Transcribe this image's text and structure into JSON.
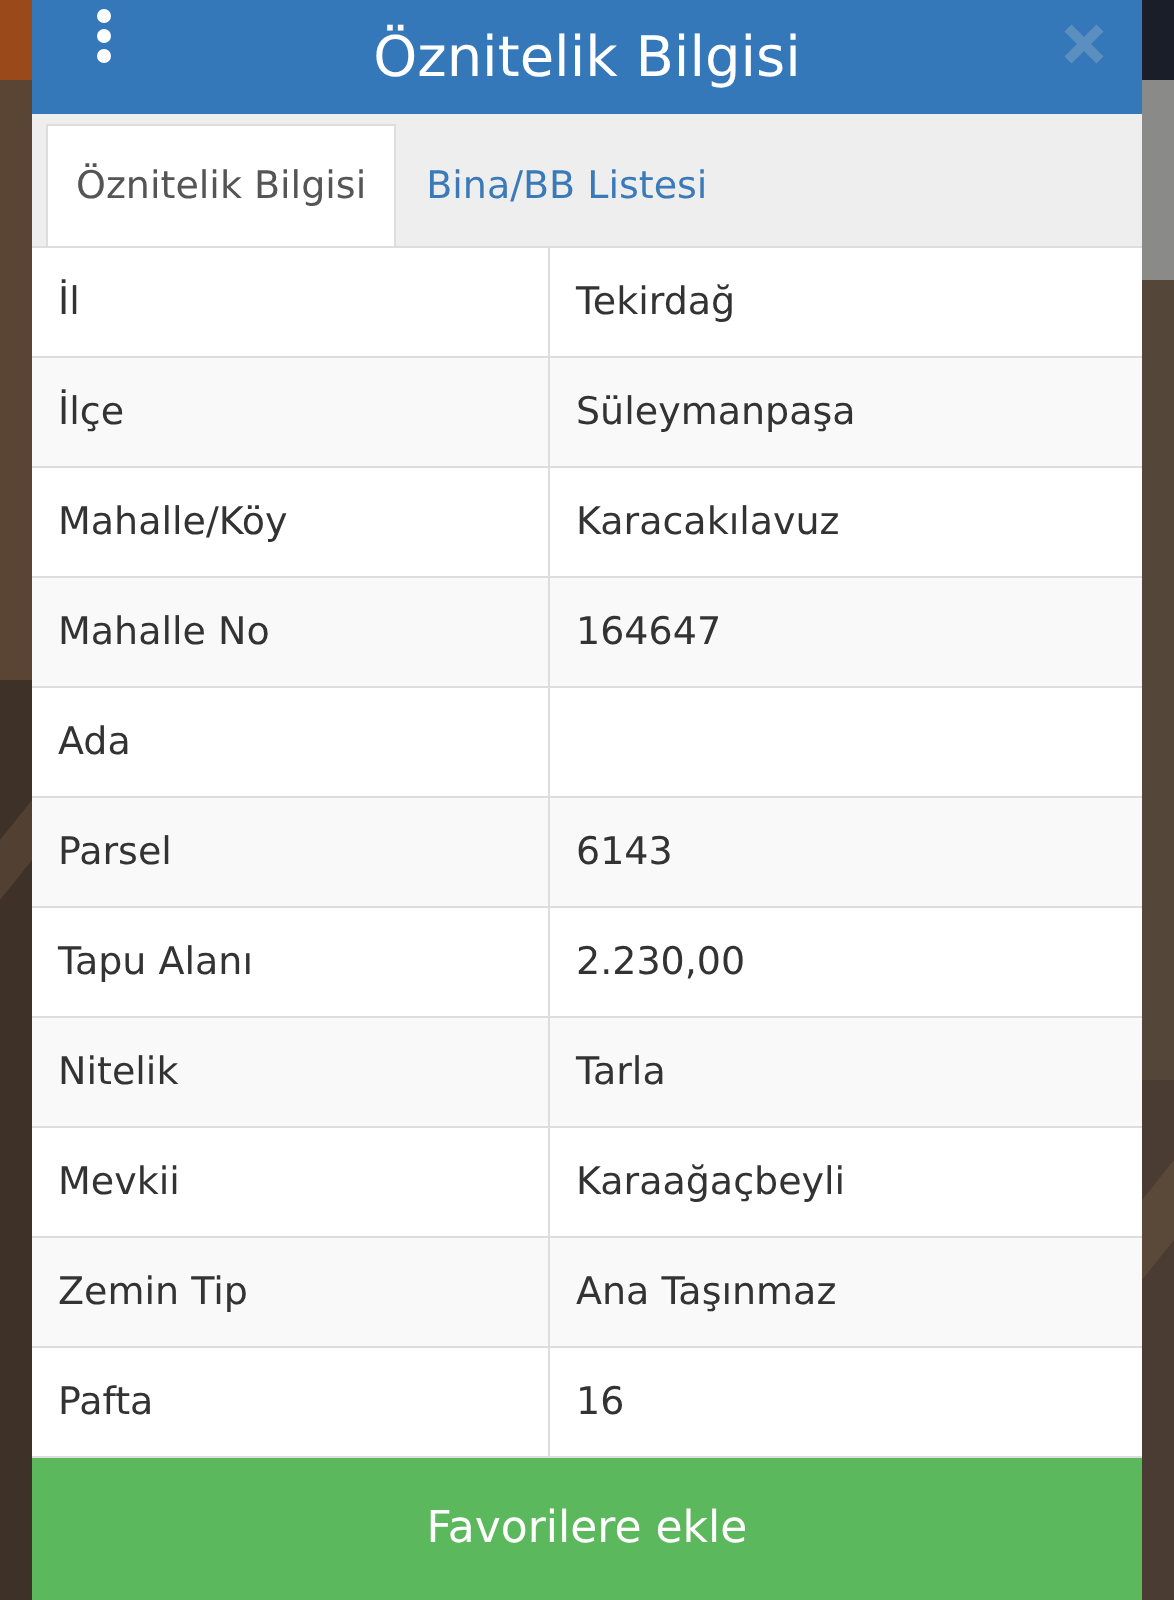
{
  "dialog": {
    "title": "Öznitelik Bilgisi"
  },
  "tabs": [
    {
      "label": "Öznitelik Bilgisi",
      "selected": true
    },
    {
      "label": "Bina/BB Listesi",
      "selected": false
    }
  ],
  "rows": [
    {
      "label": "İl",
      "value": "Tekirdağ"
    },
    {
      "label": "İlçe",
      "value": "Süleymanpaşa"
    },
    {
      "label": "Mahalle/Köy",
      "value": "Karacakılavuz"
    },
    {
      "label": "Mahalle No",
      "value": "164647"
    },
    {
      "label": "Ada"
    },
    {
      "label": "Parsel",
      "value": "6143"
    },
    {
      "label": "Tapu Alanı",
      "value": "2.230,00"
    },
    {
      "label": "Nitelik",
      "value": "Tarla"
    },
    {
      "label": "Mevkii",
      "value": "Karaağaçbeyli"
    },
    {
      "label": "Zemin Tip",
      "value": "Ana Taşınmaz"
    },
    {
      "label": "Pafta",
      "value": "16"
    }
  ],
  "button": {
    "label": "Favorilere ekle"
  }
}
